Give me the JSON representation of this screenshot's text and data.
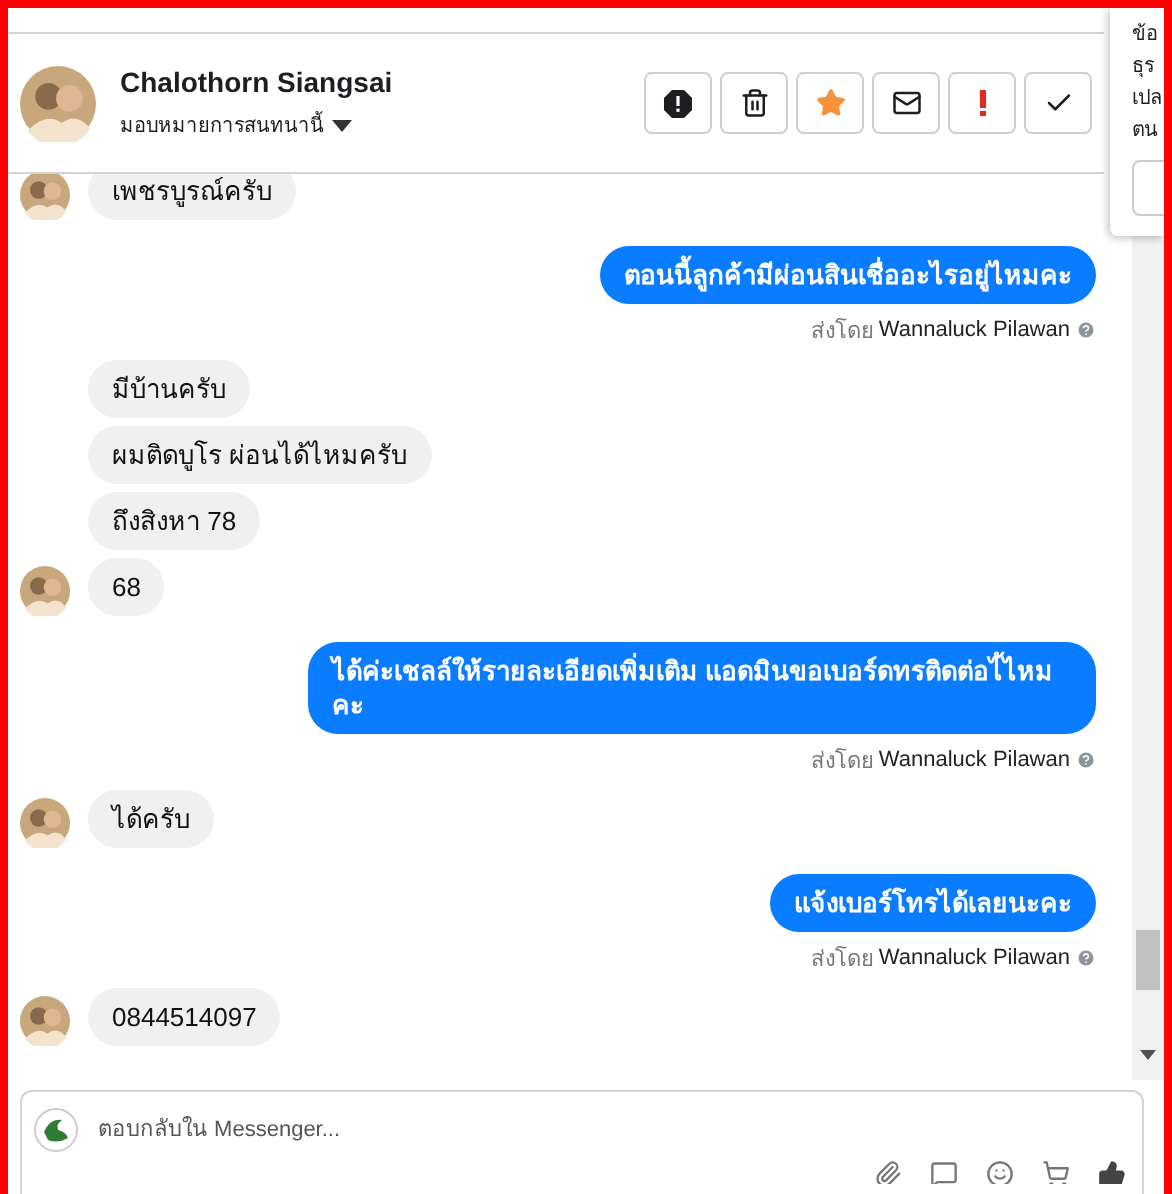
{
  "contact": {
    "name": "Chalothorn Siangsai",
    "assign_label": "มอบหมายการสนทนานี้"
  },
  "actions": [
    {
      "kind": "block"
    },
    {
      "kind": "delete"
    },
    {
      "kind": "star"
    },
    {
      "kind": "unread"
    },
    {
      "kind": "important"
    },
    {
      "kind": "done"
    }
  ],
  "messages": [
    {
      "kind": "incoming",
      "text": "เพชรบูรณ์ครับ",
      "avatar": true
    },
    {
      "kind": "outgoing",
      "text": "ตอนนี้ลูกค้ามีผ่อนสินเชื่ออะไรอยู่ไหมคะ",
      "sent_label": "ส่งโดย",
      "sender": "Wannaluck Pilawan"
    },
    {
      "kind": "incoming",
      "text": "มีบ้านครับ",
      "avatar": false
    },
    {
      "kind": "incoming",
      "text": "ผมติดบูโร ผ่อนได้ไหมครับ",
      "avatar": false
    },
    {
      "kind": "incoming",
      "text": "ถึงสิงหา 78",
      "avatar": false
    },
    {
      "kind": "incoming",
      "text": "68",
      "avatar": true
    },
    {
      "kind": "outgoing",
      "text": "ได้ค่ะเชลล์ให้รายละเอียดเพิ่มเติม  แอดมินขอเบอร์ดทรติดต่อไ้ไหมคะ",
      "sent_label": "ส่งโดย",
      "sender": "Wannaluck Pilawan"
    },
    {
      "kind": "incoming",
      "text": "ได้ครับ",
      "avatar": true
    },
    {
      "kind": "outgoing",
      "text": "แจ้งเบอร์โทรได้เลยนะคะ",
      "sent_label": "ส่งโดย",
      "sender": "Wannaluck Pilawan"
    },
    {
      "kind": "incoming",
      "text": "0844514097",
      "avatar": true
    }
  ],
  "composer": {
    "placeholder": "ตอบกลับใน Messenger..."
  },
  "side_panel": {
    "lines": [
      "ข้อ",
      "ธุร",
      "เปล",
      "ตน"
    ]
  }
}
